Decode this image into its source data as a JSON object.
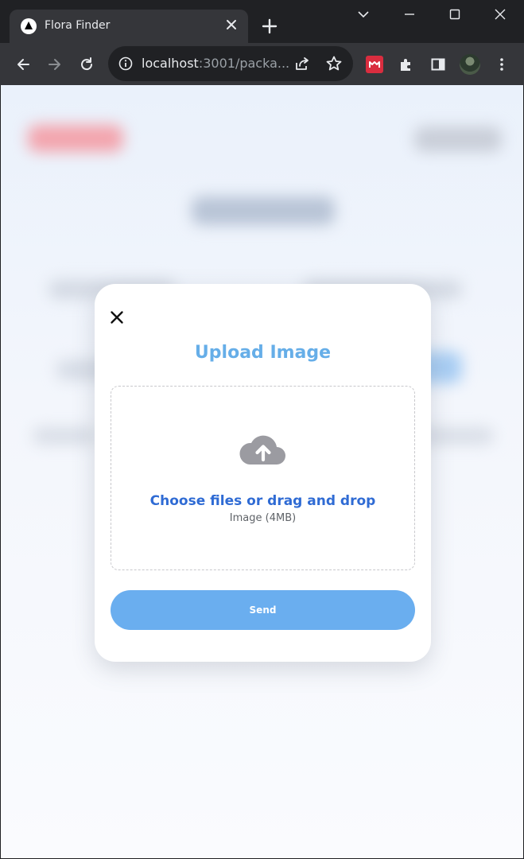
{
  "browser": {
    "tab_title": "Flora Finder",
    "url_host": "localhost",
    "url_path": ":3001/packa...",
    "icons": {
      "favicon": "triangle-logo-icon",
      "tab_close": "close-icon",
      "new_tab": "plus-icon",
      "tab_search": "chevron-down-icon",
      "minimize": "minimize-icon",
      "maximize": "maximize-icon",
      "close_window": "close-icon",
      "back": "arrow-left-icon",
      "forward": "arrow-right-icon",
      "reload": "reload-icon",
      "site_info": "info-icon",
      "share": "share-icon",
      "bookmark": "star-icon",
      "extension": "puzzle-icon",
      "side_panel": "side-panel-icon",
      "menu": "kebab-menu-icon"
    }
  },
  "modal": {
    "title": "Upload Image",
    "dropzone": {
      "title": "Choose files or drag and drop",
      "subtitle": "Image (4MB)",
      "icon": "cloud-upload-icon"
    },
    "send_label": "Send",
    "close_icon": "close-icon"
  },
  "colors": {
    "accent": "#66aee8",
    "link": "#2f6bd4",
    "button": "#6aaeef",
    "extension_red": "#d92d3f"
  }
}
